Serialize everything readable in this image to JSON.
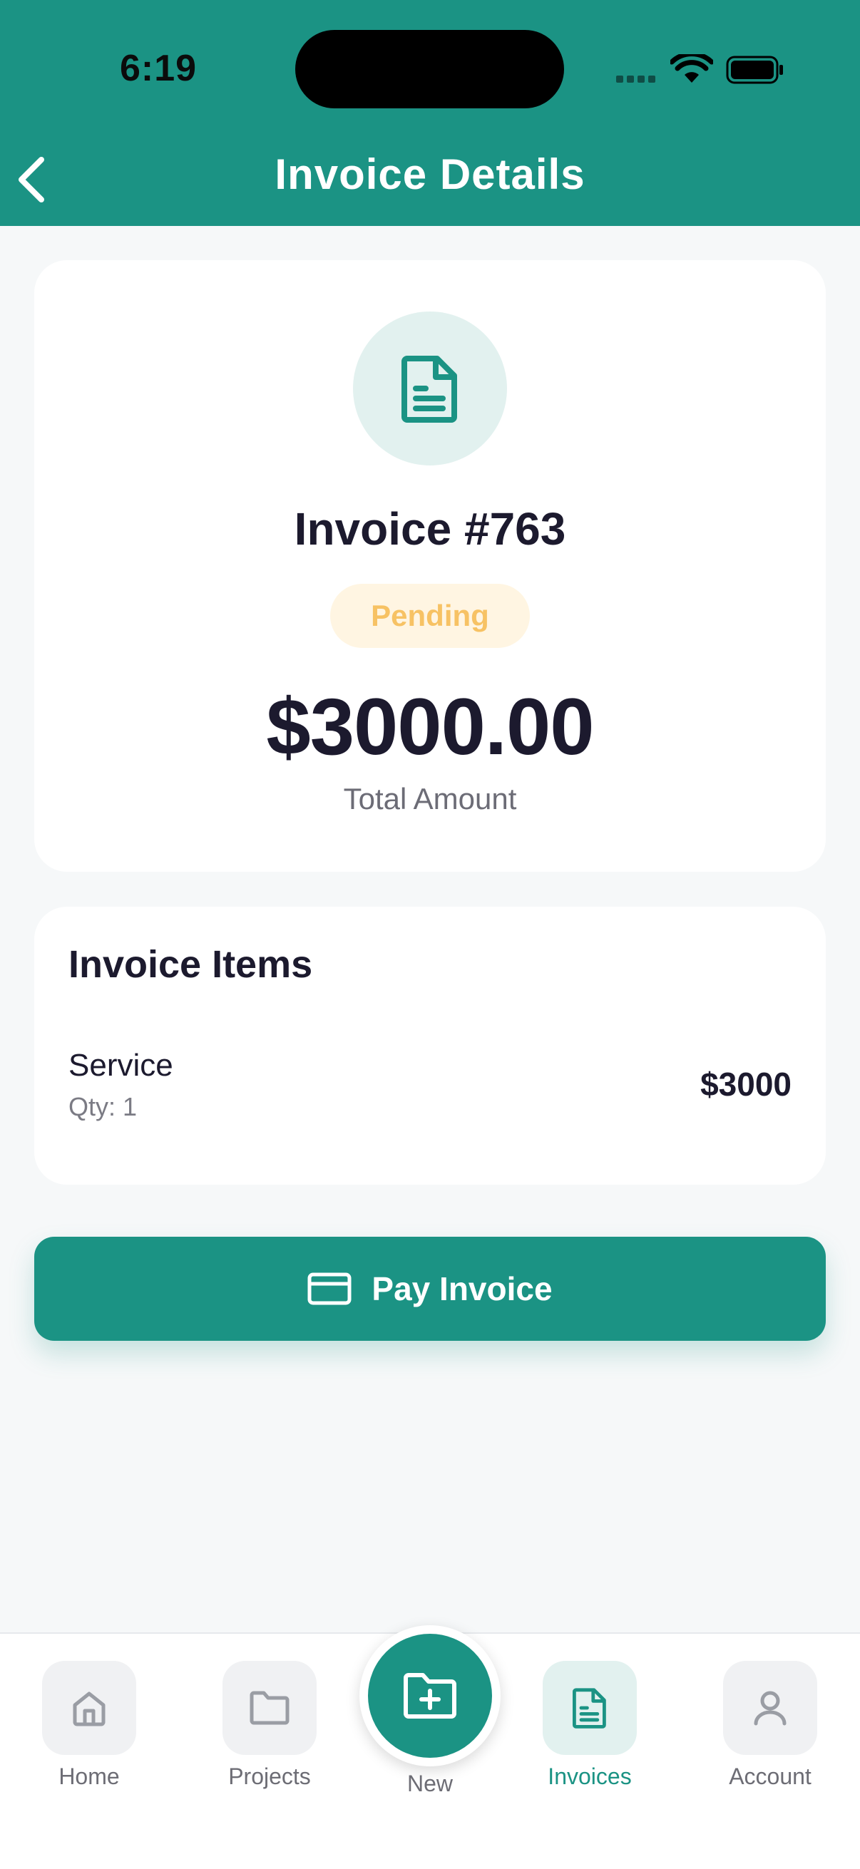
{
  "status_bar": {
    "time": "6:19"
  },
  "header": {
    "title": "Invoice Details",
    "back_icon": "chevron-left-icon"
  },
  "invoice": {
    "number": "Invoice #763",
    "status": "Pending",
    "total": "$3000.00",
    "total_label": "Total Amount"
  },
  "items_section": {
    "title": "Invoice Items",
    "items": [
      {
        "name": "Service",
        "qty": "Qty: 1",
        "price": "$3000"
      }
    ]
  },
  "pay_button": {
    "label": "Pay Invoice",
    "icon": "credit-card-icon"
  },
  "tabbar": {
    "tabs": [
      {
        "label": "Home",
        "icon": "home-icon"
      },
      {
        "label": "Projects",
        "icon": "folder-icon"
      },
      {
        "label": "New",
        "icon": "folder-plus-icon"
      },
      {
        "label": "Invoices",
        "icon": "document-icon",
        "active": true
      },
      {
        "label": "Account",
        "icon": "user-icon"
      }
    ]
  },
  "colors": {
    "primary": "#1b9384",
    "badge_bg": "#fff5e2",
    "badge_text": "#f7c264",
    "text_dark": "#1c1a2e"
  }
}
